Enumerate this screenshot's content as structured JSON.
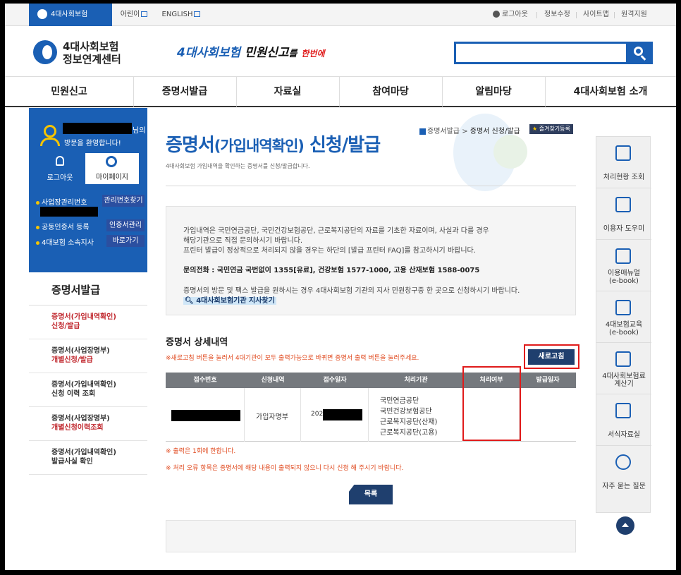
{
  "util": {
    "home": "4대사회보험",
    "kids": "어린이",
    "english": "ENGLISH",
    "logout": "로그아웃",
    "edit_info": "정보수정",
    "sitemap": "사이트맵",
    "remote": "원격지원"
  },
  "header": {
    "logo_line1": "4대사회보험",
    "logo_line2": "정보연계센터",
    "slogan_blue": "4대사회보험",
    "slogan_black": "민원신고",
    "slogan_tail": "를",
    "slogan_red": "한번에",
    "search_placeholder": ""
  },
  "gnb": [
    "민원신고",
    "증명서발급",
    "자료실",
    "참여마당",
    "알림마당",
    "4대사회보험 소개"
  ],
  "left_panel": {
    "greet_suffix": "님의",
    "welcome": "방문을 환영합니다!",
    "logout": "로그아웃",
    "mypage": "마이페이지",
    "biz_no_label": "사업장관리번호",
    "biz_no_btn": "관리번호찾기",
    "cert_label": "공동인증서 등록",
    "cert_btn": "인증서관리",
    "branch_label": "4대보험 소속지사",
    "branch_btn": "바로가기"
  },
  "lnb": {
    "title": "증명서발급",
    "items": [
      {
        "l1": "증명서(가입내역확인)",
        "l2": "신청/발급"
      },
      {
        "l1": "증명서(사업장명부)",
        "l2": "개별신청/발급"
      },
      {
        "l1": "증명서(가입내역확인)",
        "l2": "신청 이력 조회"
      },
      {
        "l1": "증명서(사업장명부)",
        "l2": "개별신청이력조회"
      },
      {
        "l1": "증명서(가입내역확인)",
        "l2": "발급사실 확인"
      }
    ]
  },
  "breadcrumb": {
    "parent": "증명서발급",
    "sep": ">",
    "current": "증명서 신청/발급",
    "fav": "즐겨찾기등록"
  },
  "page": {
    "title_a": "증명서",
    "title_b": "(가입내역확인)",
    "title_c": " 신청/발급",
    "subtitle": "4대사회보험 가입내역을 확인하는 증명서를 신청/발급합니다."
  },
  "info": {
    "line1": "가입내역은 국민연금공단, 국민건강보험공단, 근로복지공단의 자료를 기초한 자료이며, 사실과 다를 경우",
    "line2": "해당기관으로 직접 문의하시기 바랍니다.",
    "line3": "프린터 발급이 정상적으로 처리되지 않을 경우는 하단의 [발급 프린터 FAQ]를 참고하시기 바랍니다.",
    "phone": "문의전화 : 국민연금 국번없이 1355[유료], 건강보험 1577-1000, 고용 산재보험 1588-0075",
    "visit": "증명서의 방문 및 팩스 발급을 원하시는 경우 4대사회보험 기관의 지사 민원창구중 한 곳으로 신청하시기 바랍니다.",
    "link": "4대사회보험기관 지사찾기"
  },
  "detail": {
    "title": "증명서 상세내역",
    "notice": "※새로고침 버튼을 눌러서 4대기관이 모두 출력가능으로 바뀌면 증명서 출력 버튼을 눌러주세요.",
    "refresh": "새로고침",
    "headers": [
      "접수번호",
      "신청내역",
      "접수일자",
      "처리기관",
      "처리여부",
      "발급일자"
    ],
    "row": {
      "type": "가입자명부",
      "date_prefix": "2021",
      "orgs": [
        "국민연금공단",
        "국민건강보험공단",
        "근로복지공단(산재)",
        "근로복지공단(고용)"
      ]
    }
  },
  "warnings": [
    "※ 출력은 1회에 한합니다.",
    "※ 처리 오류 항목은 증명서에 해당 내용이 출력되지 않으니 다시 신청 해 주시기 바랍니다."
  ],
  "list_btn": "목록",
  "quick_menu": [
    {
      "label": "처리현황 조회",
      "icon": "document-check-icon"
    },
    {
      "label": "이용자 도우미",
      "icon": "help-monitor-icon"
    },
    {
      "label": "이용매뉴얼\n(e-book)",
      "icon": "manual-icon"
    },
    {
      "label": "4대보험교육\n(e-book)",
      "icon": "education-book-icon"
    },
    {
      "label": "4대사회보험료\n계산기",
      "icon": "calculator-icon"
    },
    {
      "label": "서식자료실",
      "icon": "form-list-icon"
    },
    {
      "label": "자주 묻는 질문",
      "icon": "faq-bubble-icon"
    }
  ],
  "colors": {
    "brand": "#1a5fb4",
    "dark_button": "#1f3f6e",
    "alert": "#e04a1f",
    "highlight_box": "#e01b1b"
  }
}
